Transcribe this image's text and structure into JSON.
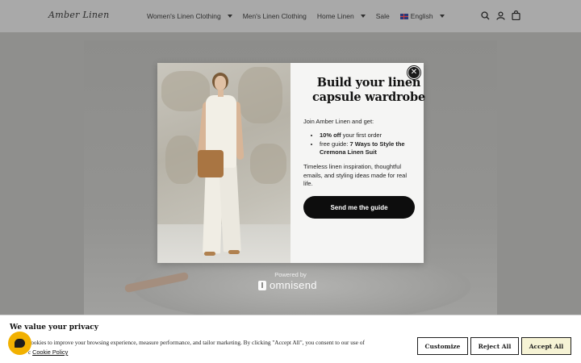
{
  "header": {
    "logo": "Amber Linen",
    "nav": [
      {
        "label": "Women's Linen Clothing",
        "has_dropdown": true
      },
      {
        "label": "Men's Linen Clothing",
        "has_dropdown": false
      },
      {
        "label": "Home Linen",
        "has_dropdown": true
      },
      {
        "label": "Sale",
        "has_dropdown": false
      },
      {
        "label": "English",
        "has_dropdown": true,
        "icon": "uk-flag-icon"
      }
    ],
    "icons": [
      "search-icon",
      "account-icon",
      "cart-icon"
    ]
  },
  "popup": {
    "title": "Build your linen capsule wardrobe",
    "intro": "Join Amber Linen and get:",
    "benefits": [
      {
        "bold": "10% off",
        "text": " your first order"
      },
      {
        "prefix": "free guide: ",
        "bold": "7 Ways to Style the Cremona Linen Suit"
      }
    ],
    "description": "Timeless linen inspiration, thoughtful emails, and styling ideas made for real life.",
    "cta": "Send me the guide",
    "close_symbol": "✕",
    "powered_by": "Powered by",
    "brand": "omnisend"
  },
  "cookie_banner": {
    "title": "We value your privacy",
    "text": "cookies to improve your browsing experience, measure performance, and tailor marketing. By clicking \"Accept All\", you consent to our use of",
    "text_line2_prefix": "c",
    "policy_link": "Cookie Policy",
    "buttons": {
      "customize": "Customize",
      "reject": "Reject All",
      "accept": "Accept All"
    },
    "accept_color": "#f6f3d5"
  },
  "colors": {
    "header_bg": "#a9a9a9",
    "overlay_bg": "#8f8f8d",
    "cta_bg": "#0d0d0d",
    "chat_widget": "#f2b100"
  }
}
